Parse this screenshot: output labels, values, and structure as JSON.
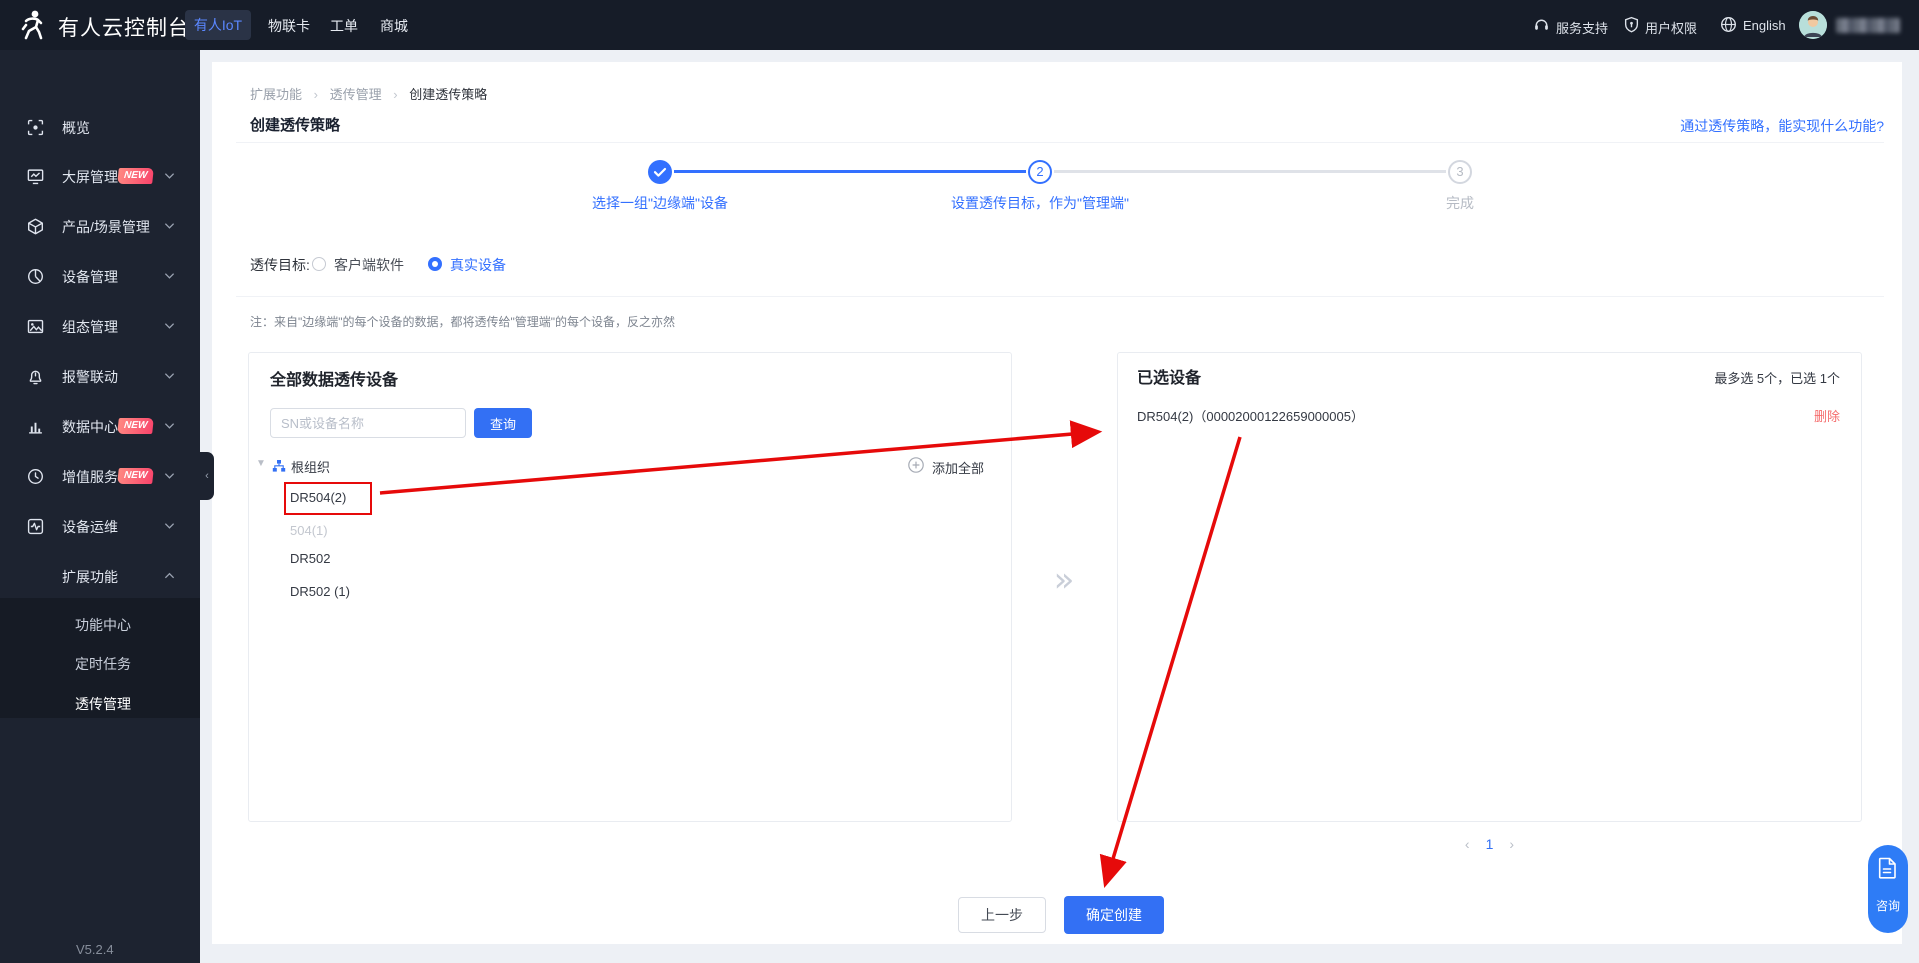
{
  "header": {
    "logo_text": "有人云控制台",
    "nav": [
      {
        "label": "有人IoT",
        "active": true
      },
      {
        "label": "物联卡",
        "active": false
      },
      {
        "label": "工单",
        "active": false
      },
      {
        "label": "商城",
        "active": false
      }
    ],
    "right": {
      "support": "服务支持",
      "permission": "用户权限",
      "language": "English"
    }
  },
  "sidebar": {
    "items": [
      {
        "label": "概览"
      },
      {
        "label": "大屏管理",
        "badge": "NEW"
      },
      {
        "label": "产品/场景管理"
      },
      {
        "label": "设备管理"
      },
      {
        "label": "组态管理"
      },
      {
        "label": "报警联动"
      },
      {
        "label": "数据中心",
        "badge": "NEW"
      },
      {
        "label": "增值服务",
        "badge": "NEW"
      },
      {
        "label": "设备运维"
      },
      {
        "label": "扩展功能"
      }
    ],
    "sub_items": [
      {
        "label": "功能中心"
      },
      {
        "label": "定时任务"
      },
      {
        "label": "透传管理",
        "active": true
      }
    ],
    "version": "V5.2.4"
  },
  "breadcrumb": {
    "items": [
      "扩展功能",
      "透传管理",
      "创建透传策略"
    ]
  },
  "page": {
    "title": "创建透传策略",
    "help_link": "通过透传策略，能实现什么功能?"
  },
  "steps": [
    {
      "num": "1",
      "label": "选择一组\"边缘端\"设备",
      "state": "done"
    },
    {
      "num": "2",
      "label": "设置透传目标，作为\"管理端\"",
      "state": "active"
    },
    {
      "num": "3",
      "label": "完成",
      "state": "pending"
    }
  ],
  "target": {
    "label": "透传目标:",
    "options": [
      {
        "label": "客户端软件",
        "selected": false
      },
      {
        "label": "真实设备",
        "selected": true
      }
    ]
  },
  "note": "注：来自\"边缘端\"的每个设备的数据，都将透传给\"管理端\"的每个设备，反之亦然",
  "left_panel": {
    "title": "全部数据透传设备",
    "search_placeholder": "SN或设备名称",
    "search_button": "查询",
    "tree_root": "根组织",
    "add_all": "添加全部",
    "devices": [
      {
        "name": "DR504(2)",
        "highlighted": true
      },
      {
        "name": "504(1)",
        "disabled": true
      },
      {
        "name": "DR502",
        "disabled": false
      },
      {
        "name": "DR502 (1)",
        "disabled": false
      }
    ]
  },
  "right_panel": {
    "title": "已选设备",
    "limit_text": "最多选 5个，已选 1个",
    "selected": [
      {
        "name": "DR504(2)（00002000122659000005）",
        "remove_label": "删除"
      }
    ],
    "pagination": {
      "current": "1"
    }
  },
  "footer": {
    "prev": "上一步",
    "confirm": "确定创建"
  },
  "floating": {
    "label": "咨询"
  },
  "colors": {
    "accent": "#3370ff",
    "danger": "#f56c6c",
    "annotation": "#e60a0a",
    "header_bg": "#161c28",
    "sidebar_bg": "#1d2330"
  }
}
